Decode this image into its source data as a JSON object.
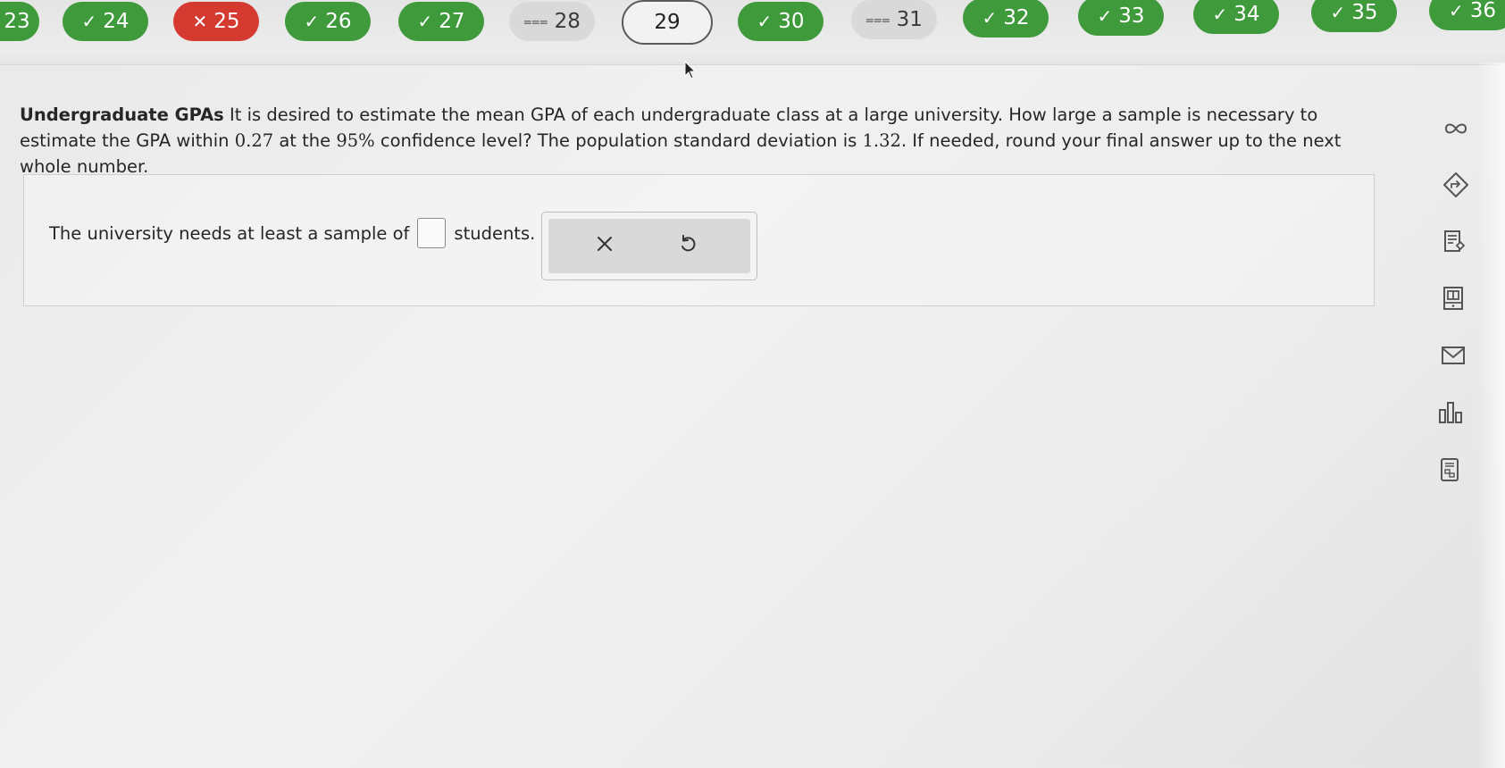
{
  "nav": {
    "items": [
      {
        "label": "23",
        "status": "correct",
        "symbol": ""
      },
      {
        "label": "24",
        "status": "correct",
        "symbol": "✓"
      },
      {
        "label": "25",
        "status": "incorrect",
        "symbol": "✕"
      },
      {
        "label": "26",
        "status": "correct",
        "symbol": "✓"
      },
      {
        "label": "27",
        "status": "correct",
        "symbol": "✓"
      },
      {
        "label": "28",
        "status": "partial",
        "symbol": "⩶"
      },
      {
        "label": "29",
        "status": "current",
        "symbol": ""
      },
      {
        "label": "30",
        "status": "correct",
        "symbol": "✓"
      },
      {
        "label": "31",
        "status": "partial",
        "symbol": "⩶"
      },
      {
        "label": "32",
        "status": "correct",
        "symbol": "✓"
      },
      {
        "label": "33",
        "status": "correct",
        "symbol": "✓"
      },
      {
        "label": "34",
        "status": "correct",
        "symbol": "✓"
      },
      {
        "label": "35",
        "status": "correct",
        "symbol": "✓"
      },
      {
        "label": "36",
        "status": "correct",
        "symbol": "✓"
      }
    ]
  },
  "question": {
    "title": "Undergraduate GPAs",
    "text_1": " It is desired to estimate the mean GPA of each undergraduate class at a large university. How large a sample is necessary to estimate the GPA within ",
    "margin": "0.27",
    "text_2": " at the ",
    "confidence": "95%",
    "text_3": " confidence level? The population standard deviation is ",
    "std_dev": "1.32",
    "text_4": ". If needed, round your final answer up to the next whole number."
  },
  "answer": {
    "prefix": "The university needs at least a sample of",
    "value": "",
    "suffix": "students."
  },
  "tools": {
    "clear_icon": "clear-icon",
    "undo_icon": "undo-icon"
  },
  "toolbar": {
    "icons": [
      "infinity-icon",
      "calculator-arrow-icon",
      "notes-icon",
      "reader-icon",
      "mail-icon",
      "chart-icon",
      "calculator-icon"
    ]
  },
  "colors": {
    "correct": "#3f9a3c",
    "incorrect": "#d53a30",
    "partial": "#d9d9d9"
  }
}
